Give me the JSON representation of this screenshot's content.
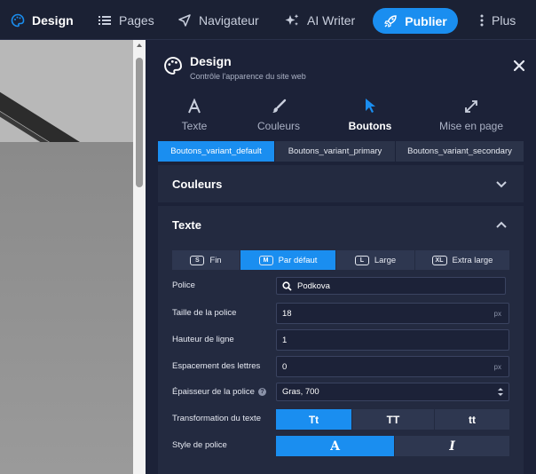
{
  "topbar": {
    "items": [
      {
        "label": "Design",
        "icon": "palette-icon",
        "active": true
      },
      {
        "label": "Pages",
        "icon": "list-icon"
      },
      {
        "label": "Navigateur",
        "icon": "navigation-arrow-icon"
      },
      {
        "label": "AI Writer",
        "icon": "sparkles-icon"
      },
      {
        "label": "Plus",
        "icon": "more-vertical-icon"
      }
    ],
    "publish_label": "Publier",
    "publish_icon": "rocket-icon"
  },
  "panel": {
    "title": "Design",
    "subtitle": "Contrôle l'apparence du site web",
    "close_icon": "close-icon",
    "tabs": [
      {
        "label": "Texte",
        "icon": "letter-a-icon"
      },
      {
        "label": "Couleurs",
        "icon": "brush-icon"
      },
      {
        "label": "Boutons",
        "icon": "cursor-icon",
        "active": true
      },
      {
        "label": "Mise en page",
        "icon": "expand-arrows-icon"
      }
    ],
    "variants": [
      "Boutons_variant_default",
      "Boutons_variant_primary",
      "Boutons_variant_secondary"
    ],
    "active_variant": 0,
    "sections": {
      "couleurs": {
        "title": "Couleurs",
        "expanded": false
      },
      "texte": {
        "title": "Texte",
        "expanded": true
      }
    },
    "sizes": [
      {
        "badge": "S",
        "label": "Fin"
      },
      {
        "badge": "M",
        "label": "Par défaut",
        "active": true
      },
      {
        "badge": "L",
        "label": "Large"
      },
      {
        "badge": "XL",
        "label": "Extra large"
      }
    ],
    "fields": {
      "police": {
        "label": "Police",
        "value": "Podkova"
      },
      "taille": {
        "label": "Taille de la police",
        "value": "18",
        "unit": "px"
      },
      "hauteur": {
        "label": "Hauteur de ligne",
        "value": "1"
      },
      "espacement": {
        "label": "Espacement des lettres",
        "value": "0",
        "unit": "px"
      },
      "epaisseur": {
        "label": "Épaisseur de la police",
        "value": "Gras, 700",
        "help": "?"
      },
      "transformation": {
        "label": "Transformation du texte",
        "options": [
          "Tt",
          "TT",
          "tt"
        ],
        "active": 0
      },
      "style": {
        "label": "Style de police",
        "options": [
          "A",
          "I"
        ],
        "active": 0
      }
    }
  },
  "colors": {
    "accent": "#1a8ef0",
    "panel_bg": "#1c2238",
    "section_bg": "#232a40"
  }
}
